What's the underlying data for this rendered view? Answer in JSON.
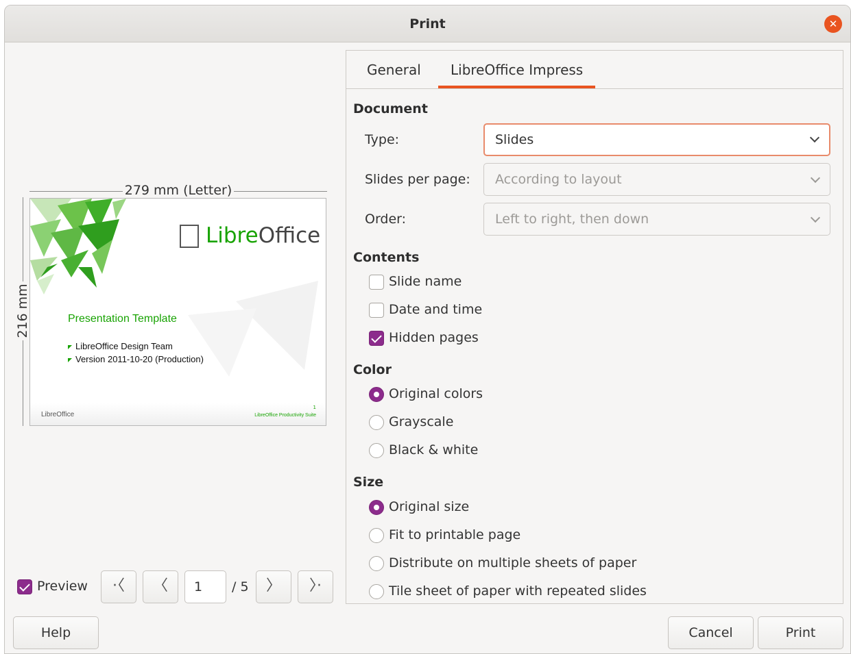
{
  "window": {
    "title": "Print"
  },
  "preview": {
    "width_label": "279 mm (Letter)",
    "height_label": "216 mm",
    "slide": {
      "brand_prefix": "Libre",
      "brand_suffix": "Office",
      "title": "Presentation Template",
      "bullets": [
        "LibreOffice Design Team",
        "Version 2011-10-20 (Production)"
      ],
      "footer_left": "LibreOffice",
      "footer_right": "LibreOffice Productivity Suite",
      "slide_number": "1"
    },
    "preview_checkbox": {
      "label": "Preview",
      "checked": true
    },
    "nav": {
      "first": "·〈",
      "prev": "〈",
      "next": "〉",
      "last": "〉·",
      "current_page": "1",
      "total": "/ 5"
    }
  },
  "tabs": [
    {
      "label": "General",
      "active": false
    },
    {
      "label": "LibreOffice Impress",
      "active": true
    }
  ],
  "document": {
    "heading": "Document",
    "type": {
      "label": "Type:",
      "value": "Slides"
    },
    "slides_per_page": {
      "label": "Slides per page:",
      "value": "According to layout"
    },
    "order": {
      "label": "Order:",
      "value": "Left to right, then down"
    }
  },
  "contents": {
    "heading": "Contents",
    "options": [
      {
        "label": "Slide name",
        "checked": false
      },
      {
        "label": "Date and time",
        "checked": false
      },
      {
        "label": "Hidden pages",
        "checked": true
      }
    ]
  },
  "color": {
    "heading": "Color",
    "options": [
      {
        "label": "Original colors",
        "selected": true
      },
      {
        "label": "Grayscale",
        "selected": false
      },
      {
        "label": "Black & white",
        "selected": false
      }
    ]
  },
  "size": {
    "heading": "Size",
    "options": [
      {
        "label": "Original size",
        "selected": true
      },
      {
        "label": "Fit to printable page",
        "selected": false
      },
      {
        "label": "Distribute on multiple sheets of paper",
        "selected": false
      },
      {
        "label": "Tile sheet of paper with repeated slides",
        "selected": false
      }
    ]
  },
  "buttons": {
    "help": "Help",
    "cancel": "Cancel",
    "print": "Print"
  },
  "colors": {
    "accent": "#e95420",
    "check": "#8c2c8c",
    "brand_green": "#18a303"
  }
}
